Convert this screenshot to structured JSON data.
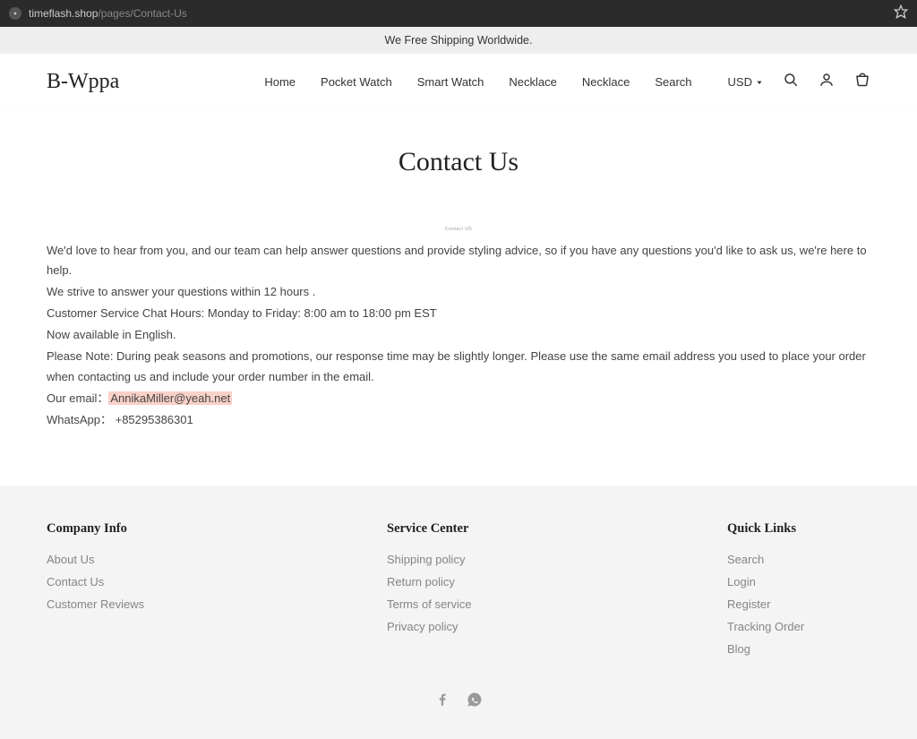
{
  "browser": {
    "url_host": "timeflash.shop",
    "url_path": "/pages/Contact-Us"
  },
  "announce": "We Free Shipping Worldwide.",
  "logo": "B-Wppa",
  "nav": {
    "items": [
      "Home",
      "Pocket Watch",
      "Smart Watch",
      "Necklace",
      "Necklace",
      "Search"
    ]
  },
  "currency": "USD",
  "page": {
    "title": "Contact Us",
    "breadcrumb": "Contact US",
    "p1": "We'd love to hear from you, and our team can help answer questions and provide styling advice, so if you have any questions you'd like to ask us, we're here to help.",
    "p2": "We strive to answer your questions within 12 hours .",
    "p3": "Customer Service Chat Hours: Monday to Friday: 8:00 am to 18:00 pm EST",
    "p4": "Now available in English.",
    "p5": "Please Note: During peak seasons and promotions, our response time may be slightly longer. Please use the same email address you used to place your order when contacting us and include your order number in the email.",
    "email_label": "Our email：",
    "email_value": "AnnikaMiller@yeah.net",
    "whatsapp_label": "WhatsApp：",
    "whatsapp_value": "+85295386301"
  },
  "footer": {
    "col1": {
      "title": "Company Info",
      "links": [
        "About Us",
        "Contact Us",
        "Customer Reviews"
      ]
    },
    "col2": {
      "title": "Service Center",
      "links": [
        "Shipping policy",
        "Return policy",
        "Terms of service",
        "Privacy policy"
      ]
    },
    "col3": {
      "title": "Quick Links",
      "links": [
        "Search",
        "Login",
        "Register",
        "Tracking Order",
        "Blog"
      ]
    }
  }
}
